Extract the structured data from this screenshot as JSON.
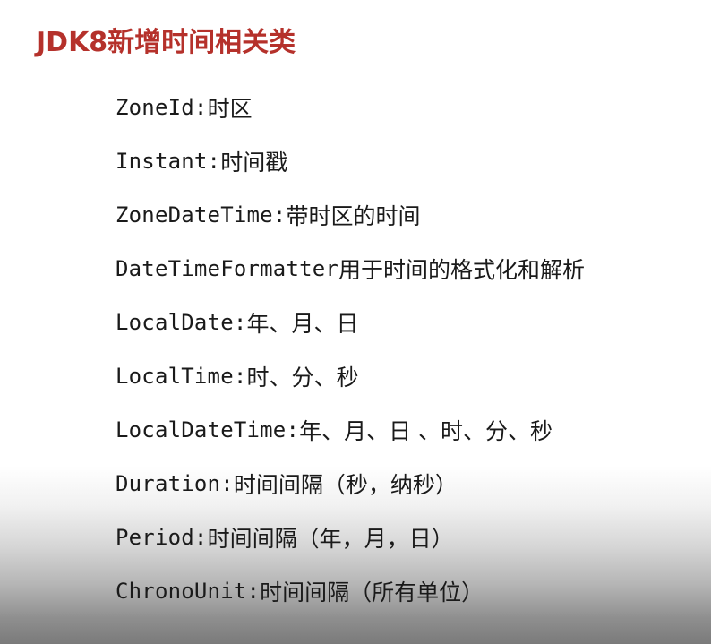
{
  "slide": {
    "title": "JDK8新增时间相关类",
    "items": [
      {
        "name": "ZoneId",
        "sep": ": ",
        "desc": "时区"
      },
      {
        "name": "Instant",
        "sep": ": ",
        "desc": "时间戳"
      },
      {
        "name": "ZoneDateTime",
        "sep": ": ",
        "desc": "带时区的时间"
      },
      {
        "name": "DateTimeFormatter",
        "sep": " ",
        "desc": "用于时间的格式化和解析"
      },
      {
        "name": "LocalDate",
        "sep": ": ",
        "desc": "年、月、日"
      },
      {
        "name": "LocalTime",
        "sep": ": ",
        "desc": "时、分、秒"
      },
      {
        "name": "LocalDateTime",
        "sep": ":",
        "desc": "年、月、日 、时、分、秒"
      },
      {
        "name": "Duration",
        "sep": ":",
        "desc": "时间间隔（秒，纳秒）"
      },
      {
        "name": "Period",
        "sep": ":",
        "desc": "时间间隔（年，月，日）"
      },
      {
        "name": "ChronoUnit",
        "sep": ": ",
        "desc": "时间间隔（所有单位）"
      }
    ]
  }
}
